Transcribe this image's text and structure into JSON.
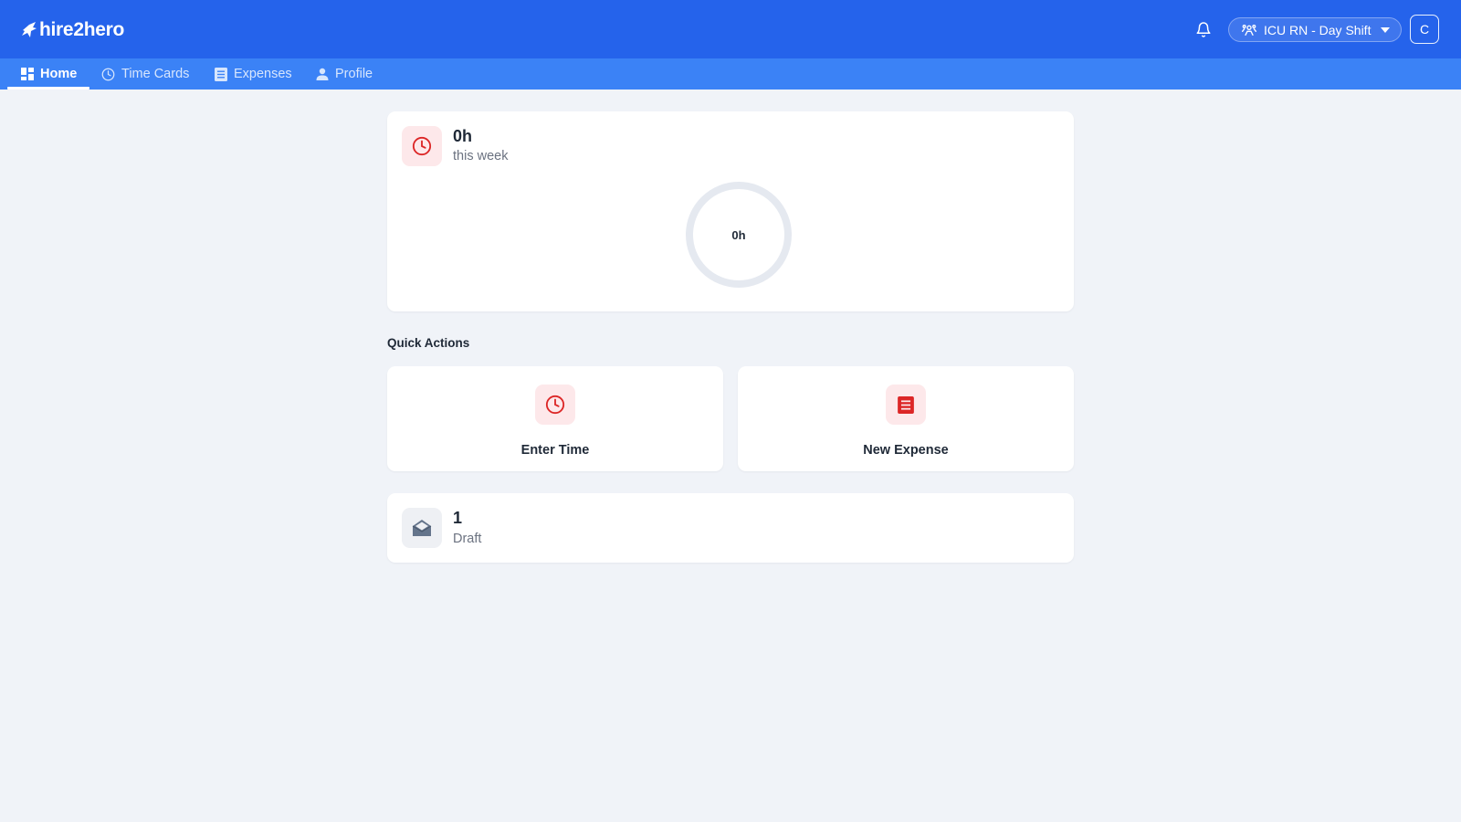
{
  "app": {
    "logo_text": "hire2hero",
    "assignment_label": "ICU RN - Day Shift",
    "avatar_initial": "C"
  },
  "nav": {
    "tabs": [
      {
        "label": "Home",
        "icon": "dashboard-icon",
        "active": true
      },
      {
        "label": "Time Cards",
        "icon": "clock-icon",
        "active": false
      },
      {
        "label": "Expenses",
        "icon": "receipt-icon",
        "active": false
      },
      {
        "label": "Profile",
        "icon": "person-icon",
        "active": false
      }
    ]
  },
  "hours_card": {
    "value": "0h",
    "caption": "this week",
    "ring_value": "0h",
    "icon": "clock-icon",
    "progress": 0
  },
  "quick_actions": {
    "title": "Quick Actions",
    "items": [
      {
        "label": "Enter Time",
        "icon": "clock-icon"
      },
      {
        "label": "New Expense",
        "icon": "receipt-icon"
      }
    ]
  },
  "drafts_card": {
    "value": "1",
    "caption": "Draft",
    "icon": "envelope-open-icon"
  },
  "colors": {
    "primary": "#2563eb",
    "nav_bg": "#3b82f6",
    "accent_red": "#dc2626",
    "icon_bg_red": "#fde8ea",
    "page_bg": "#f0f3f8"
  }
}
